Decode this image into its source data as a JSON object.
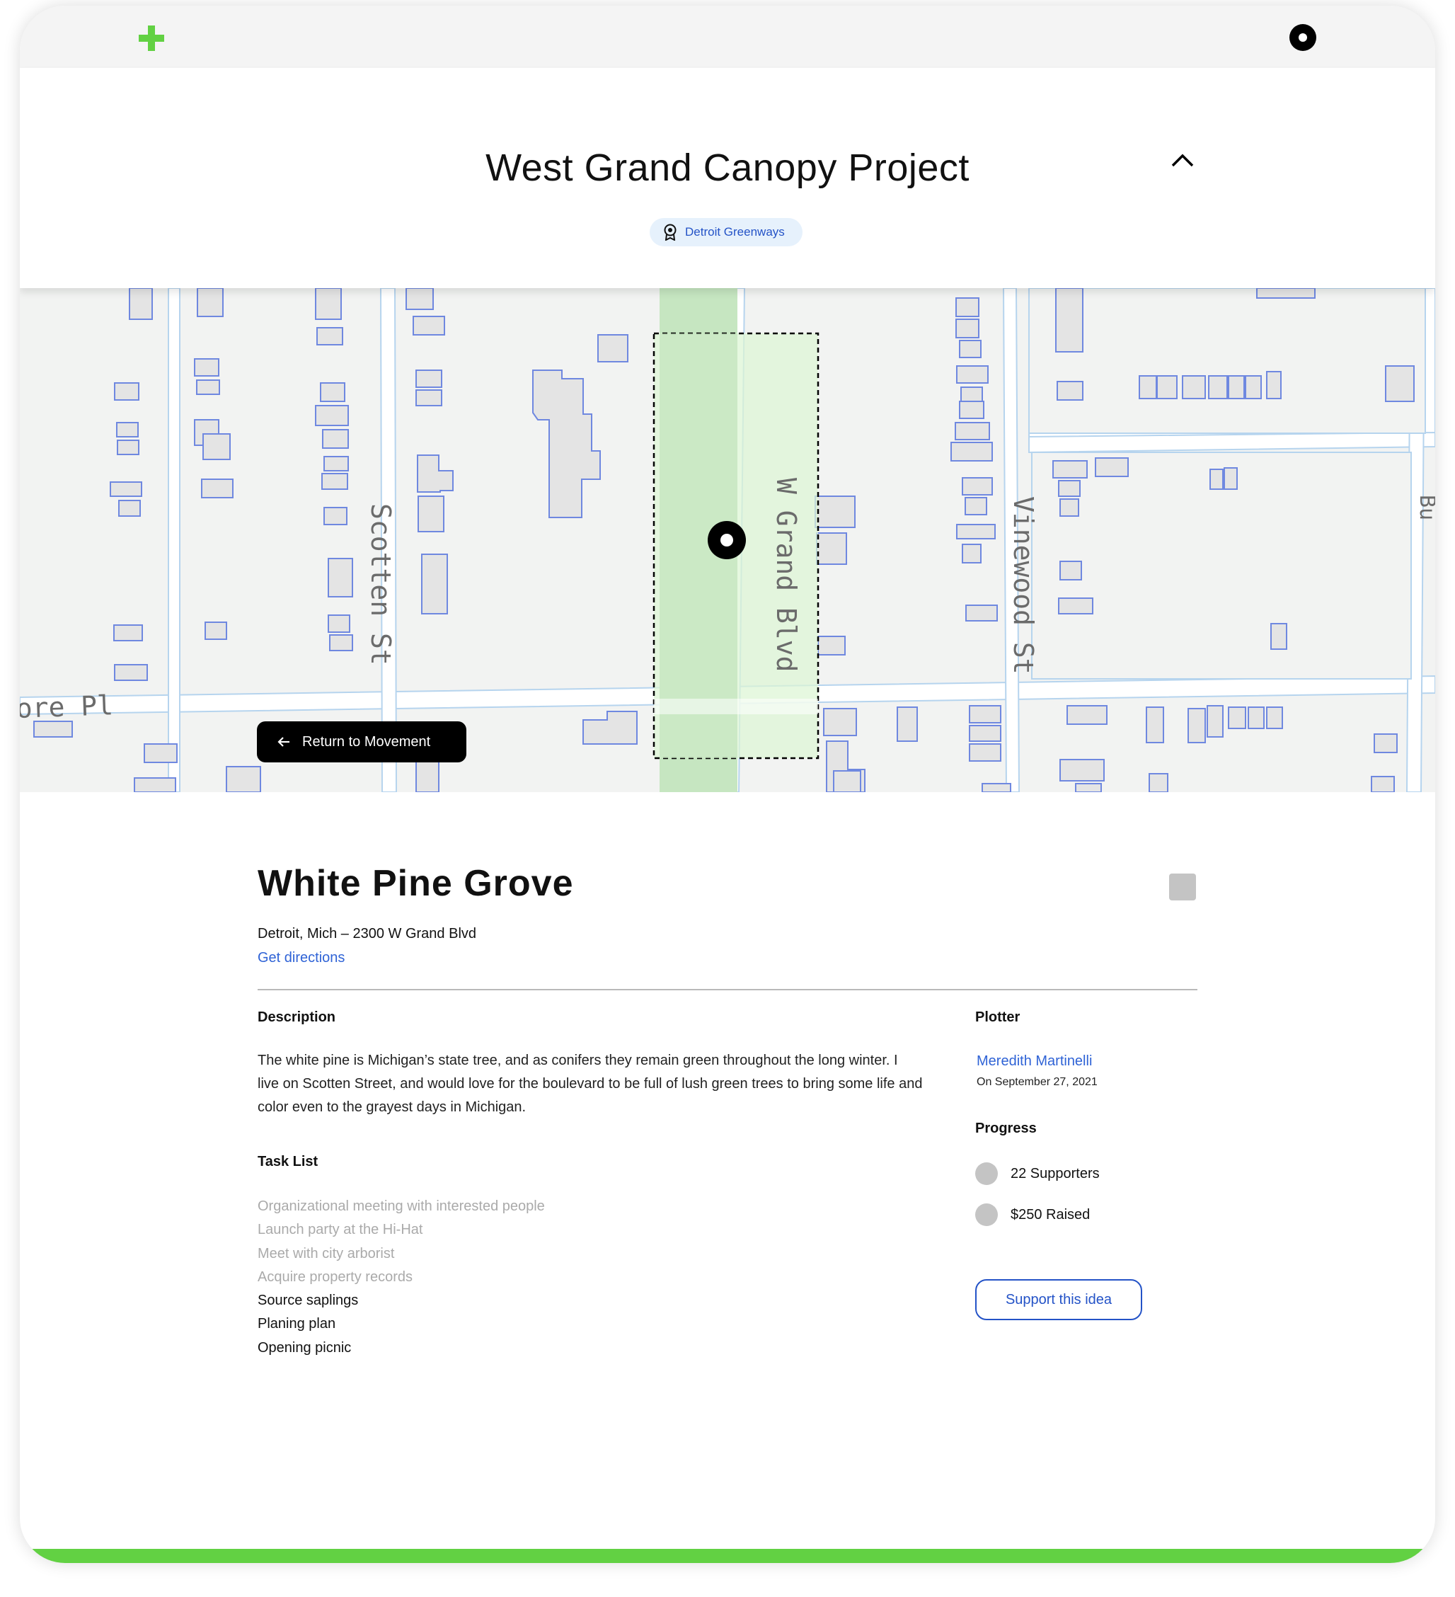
{
  "topbar": {
    "logo_icon": "plus-icon",
    "logo_color": "#62d143",
    "profile_icon": "user-icon"
  },
  "project": {
    "title": "West Grand Canopy Project",
    "collapse_icon": "chevron-up-icon",
    "organization": {
      "label": "Detroit Greenways",
      "icon": "award-icon"
    }
  },
  "map": {
    "streets": {
      "scotten": "Scotten St",
      "grand": "W Grand Blvd",
      "vinewood": "Vinewood St",
      "moore": "ore Pl",
      "edge": "Bu"
    },
    "return_label": "Return to Movement",
    "return_icon": "arrow-left-icon",
    "marker_icon": "location-marker-icon",
    "highlight_color": "#d6f5cf"
  },
  "site": {
    "title": "White Pine Grove",
    "address": "Detroit, Mich – 2300 W Grand Blvd",
    "directions_label": "Get directions",
    "bookmark_icon": "bookmark-icon"
  },
  "description": {
    "heading": "Description",
    "text": "The white pine is Michigan’s state tree, and as conifers they remain green throughout the long winter. I live on Scotten Street, and would love for the boulevard to be full of lush green trees to bring some life and color even to the grayest days in Michigan."
  },
  "tasks": {
    "heading": "Task List",
    "items": [
      {
        "label": "Organizational meeting with interested people",
        "done": true
      },
      {
        "label": "Launch party at the Hi-Hat",
        "done": true
      },
      {
        "label": "Meet with city arborist",
        "done": true
      },
      {
        "label": "Acquire property records",
        "done": true
      },
      {
        "label": "Source saplings",
        "done": false
      },
      {
        "label": "Planing plan",
        "done": false
      },
      {
        "label": "Opening picnic",
        "done": false
      }
    ]
  },
  "plotter": {
    "heading": "Plotter",
    "name": "Meredith Martinelli",
    "date": "On September 27, 2021"
  },
  "progress": {
    "heading": "Progress",
    "supporters": "22 Supporters",
    "raised": "$250 Raised",
    "support_label": "Support this idea"
  },
  "colors": {
    "accent": "#62d143",
    "link": "#2f63d6",
    "button_blue": "#2453c7"
  }
}
